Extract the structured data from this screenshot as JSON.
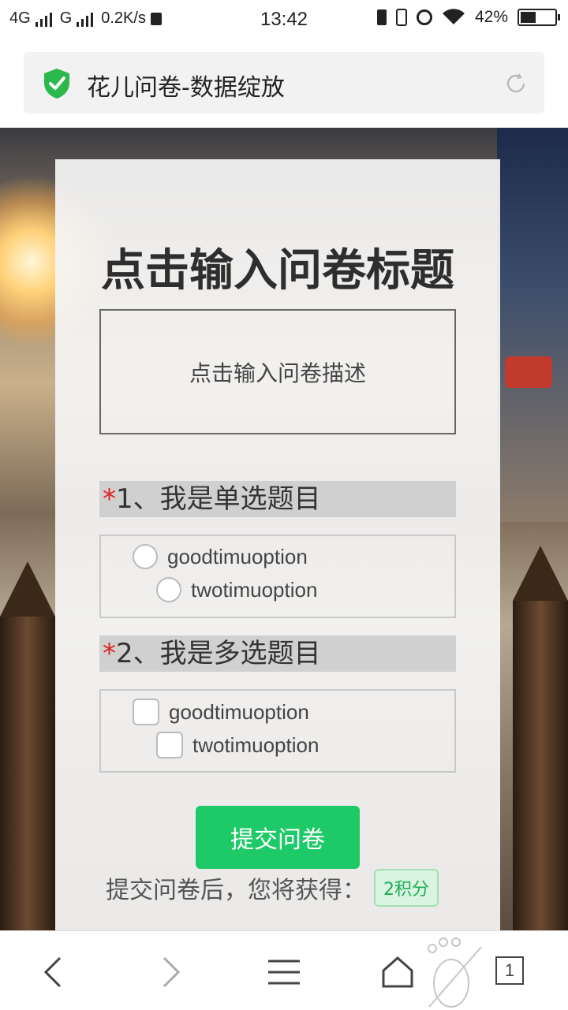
{
  "status_bar": {
    "network_1": "4G",
    "network_2": "G",
    "speed": "0.2K/s",
    "time": "13:42",
    "battery": "42%"
  },
  "browser": {
    "page_title": "花儿问卷-数据绽放",
    "tab_count": "1",
    "icons": [
      "shield-icon",
      "reload-icon",
      "back-icon",
      "forward-icon",
      "menu-icon",
      "home-icon",
      "footprint-icon",
      "tabs-icon"
    ]
  },
  "survey": {
    "title": "点击输入问卷标题",
    "description": "点击输入问卷描述",
    "questions": [
      {
        "number": "1、我是单选题目",
        "required_mark": "*",
        "type": "radio",
        "options": [
          "goodtimuoption",
          "twotimuoption"
        ]
      },
      {
        "number": "2、我是多选题目",
        "required_mark": "*",
        "type": "checkbox",
        "options": [
          "goodtimuoption",
          "twotimuoption"
        ]
      }
    ],
    "submit_label": "提交问卷",
    "reward_text": "提交问卷后，您将获得：",
    "reward_badge": "2积分"
  },
  "colors": {
    "accent_green": "#1ec968",
    "required_red": "#e02020",
    "shield_green": "#2db84d"
  }
}
